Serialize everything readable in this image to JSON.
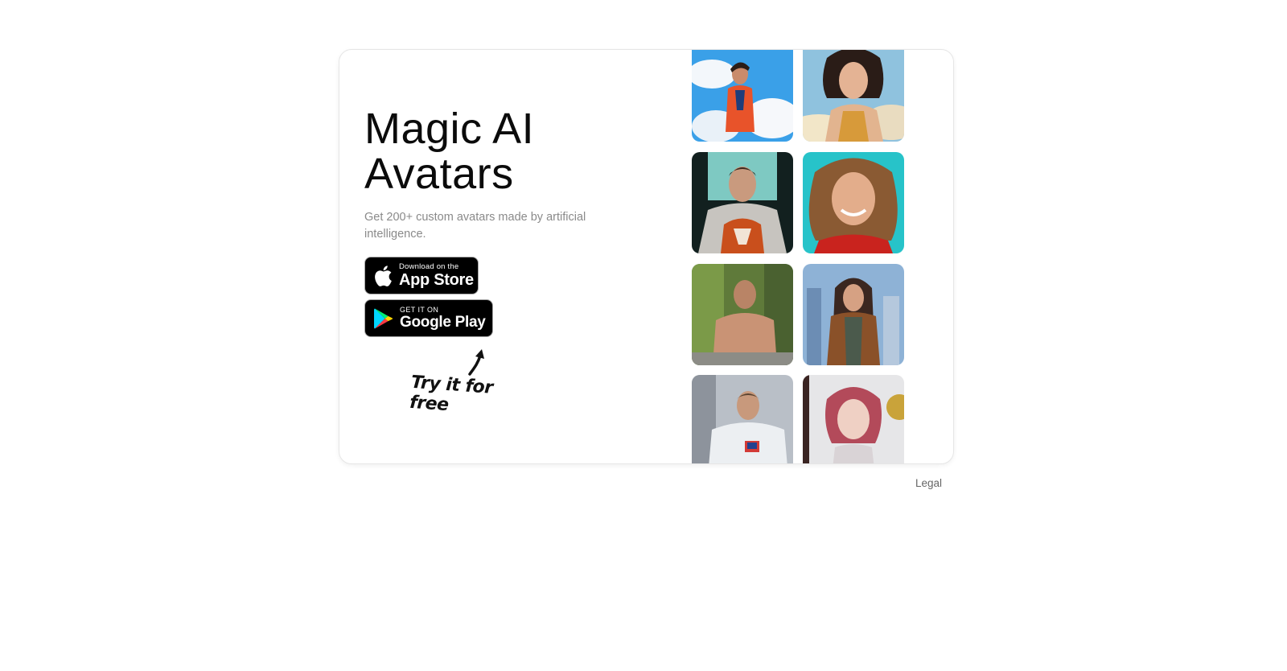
{
  "hero": {
    "title": "Magic AI Avatars",
    "subtitle": "Get 200+ custom avatars made by artificial intelligence."
  },
  "buttons": {
    "app_store": {
      "small": "Download on the",
      "big": "App Store",
      "icon": "apple-icon"
    },
    "google_play": {
      "small": "GET IT ON",
      "big": "Google Play",
      "icon": "google-play-icon"
    }
  },
  "callout": {
    "text": "Try it for free",
    "icon": "curved-arrow-icon"
  },
  "gallery": {
    "items": [
      {
        "name": "man-cartoon-sky-avatar"
      },
      {
        "name": "woman-clouds-painting-avatar"
      },
      {
        "name": "man-armor-avatar"
      },
      {
        "name": "woman-smiling-avatar"
      },
      {
        "name": "man-jungle-avatar"
      },
      {
        "name": "woman-city-avatar"
      },
      {
        "name": "man-astronaut-avatar"
      },
      {
        "name": "woman-watercolor-avatar"
      }
    ]
  },
  "footer": {
    "legal": "Legal"
  }
}
